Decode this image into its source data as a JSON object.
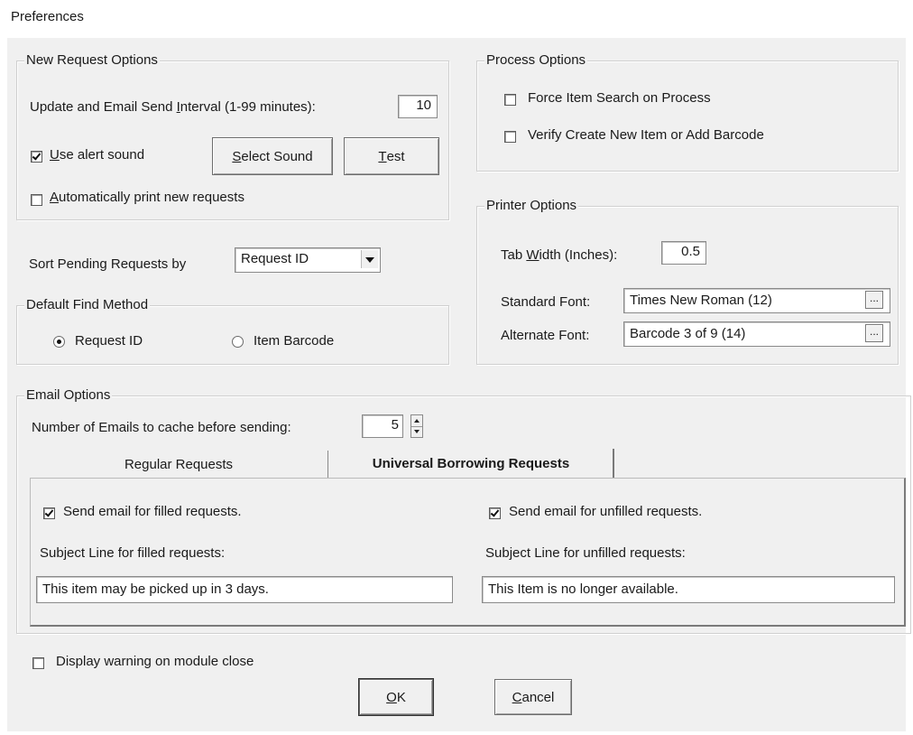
{
  "window": {
    "title": "Preferences"
  },
  "new_request": {
    "legend": "New Request Options",
    "interval_label_pre": "Update and Email Send ",
    "interval_label_u": "I",
    "interval_label_post": "nterval (1-99 minutes):",
    "interval_value": "10",
    "alert_checked": true,
    "alert_label_u": "U",
    "alert_label_rest": "se alert sound",
    "select_sound_u": "S",
    "select_sound_rest": "elect Sound",
    "test_u": "T",
    "test_rest": "est",
    "auto_print_checked": false,
    "auto_print_u": "A",
    "auto_print_rest": "utomatically print new requests"
  },
  "sort": {
    "label": "Sort Pending Requests by",
    "value": "Request ID"
  },
  "find": {
    "legend": "Default Find Method",
    "options": [
      "Request ID",
      "Item Barcode"
    ],
    "selected": "Request ID"
  },
  "process": {
    "legend": "Process Options",
    "force_search": "Force Item Search on Process",
    "verify_create": "Verify Create New Item or Add Barcode"
  },
  "printer": {
    "legend": "Printer Options",
    "tab_width_pre": "Tab ",
    "tab_width_u": "W",
    "tab_width_post": "idth (Inches):",
    "tab_width_value": "0.5",
    "standard_font_label": "Standard Font:",
    "standard_font_value": "Times New Roman (12)",
    "alternate_font_label": "Alternate Font:",
    "alternate_font_value": "Barcode 3 of 9 (14)",
    "browse_label": "..."
  },
  "email": {
    "legend": "Email Options",
    "cache_label": "Number of Emails to cache before sending:",
    "cache_value": "5",
    "tabs": [
      "Regular Requests",
      "Universal Borrowing Requests"
    ],
    "active_tab": "Universal Borrowing Requests",
    "filled_checked": true,
    "filled_label": "Send email for filled requests.",
    "filled_subject_label": "Subject Line for filled requests:",
    "filled_subject_value": "This item may be picked up in 3 days.",
    "unfilled_checked": true,
    "unfilled_label": "Send email for unfilled requests.",
    "unfilled_subject_label": "Subject Line for unfilled requests:",
    "unfilled_subject_value": "This Item is no longer available."
  },
  "footer": {
    "warning_checked": false,
    "warning_label": "Display warning on module close",
    "ok_u": "O",
    "ok_rest": "K",
    "cancel_u": "C",
    "cancel_rest": "ancel"
  }
}
